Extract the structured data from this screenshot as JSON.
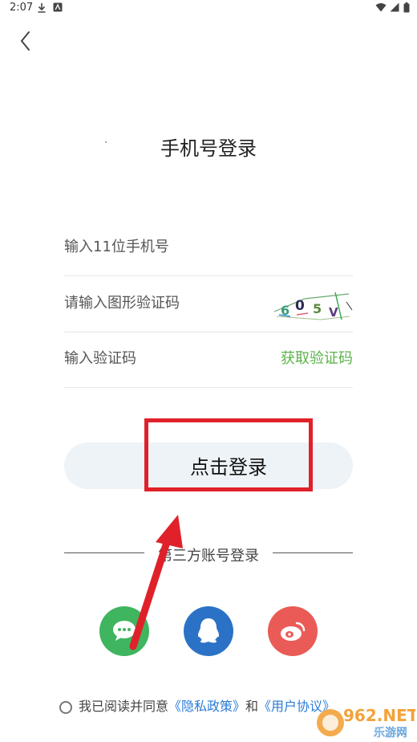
{
  "status_bar": {
    "time": "2:07"
  },
  "header": {
    "title": "手机号登录"
  },
  "form": {
    "phone_placeholder": "输入11位手机号",
    "captcha_placeholder": "请输入图形验证码",
    "captcha_text": "605V",
    "code_placeholder": "输入验证码",
    "get_code_label": "获取验证码"
  },
  "login_button": {
    "label": "点击登录"
  },
  "third_party": {
    "label": "第三方账号登录",
    "providers": [
      "wechat",
      "qq",
      "weibo"
    ]
  },
  "consent": {
    "prefix": "我已阅读并同意",
    "privacy_link": "《隐私政策》",
    "and": "和",
    "terms_link": "《用户协议》"
  },
  "watermark": {
    "brand": "962.NET",
    "sub": "乐游网"
  },
  "colors": {
    "accent_green": "#5bb24a",
    "wechat": "#3fb55f",
    "qq": "#2b72c6",
    "weibo": "#ea5b57",
    "annotation_red": "#e0212a"
  }
}
